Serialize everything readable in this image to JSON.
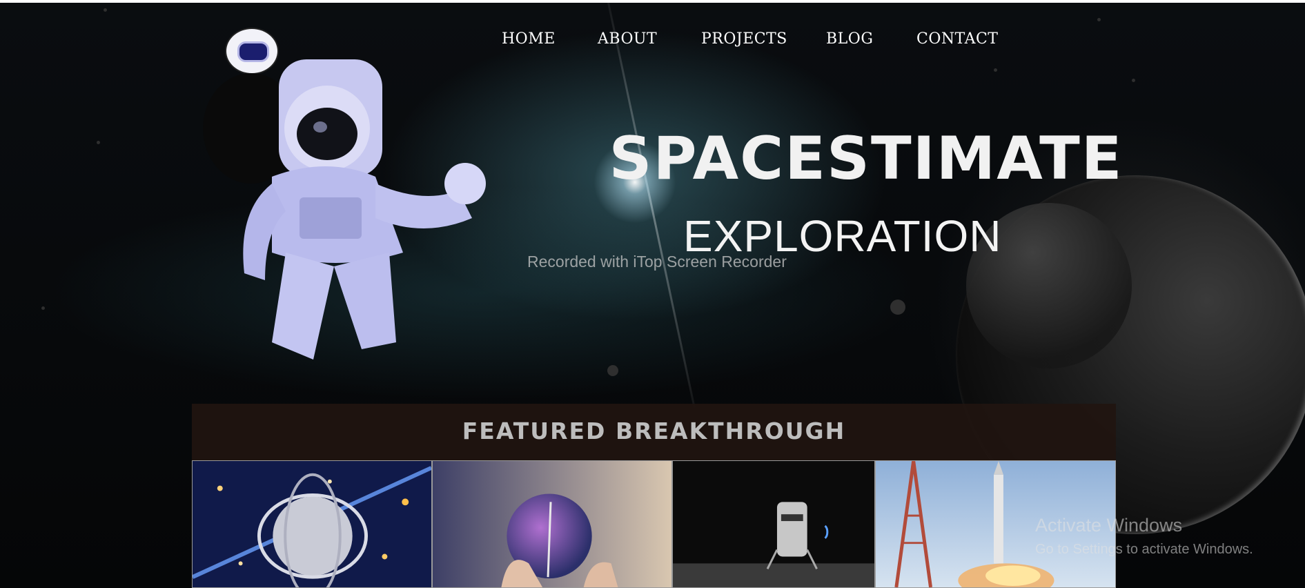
{
  "header": {
    "logo_icon": "astronaut-helmet-logo",
    "nav": [
      {
        "label": "HOME"
      },
      {
        "label": "ABOUT"
      },
      {
        "label": "PROJECTS"
      },
      {
        "label": "BLOG"
      },
      {
        "label": "CONTACT"
      }
    ]
  },
  "hero": {
    "title": "SPACESTIMATE",
    "subtitle": "EXPLORATION",
    "image": "astronaut-image"
  },
  "overlay": {
    "recorder_watermark": "Recorded with iTop Screen Recorder"
  },
  "featured": {
    "heading": "FEATURED BREAKTHROUGH",
    "cards": [
      {
        "image": "space-telescope-illustration"
      },
      {
        "image": "crystal-lens-in-hand"
      },
      {
        "image": "lunar-lander"
      },
      {
        "image": "rocket-launch"
      }
    ]
  },
  "system": {
    "activate_title": "Activate Windows",
    "activate_subtitle": "Go to Settings to activate Windows."
  },
  "colors": {
    "background": "#050709",
    "featured_bar": "#201410",
    "nav_text": "#ffffff"
  }
}
